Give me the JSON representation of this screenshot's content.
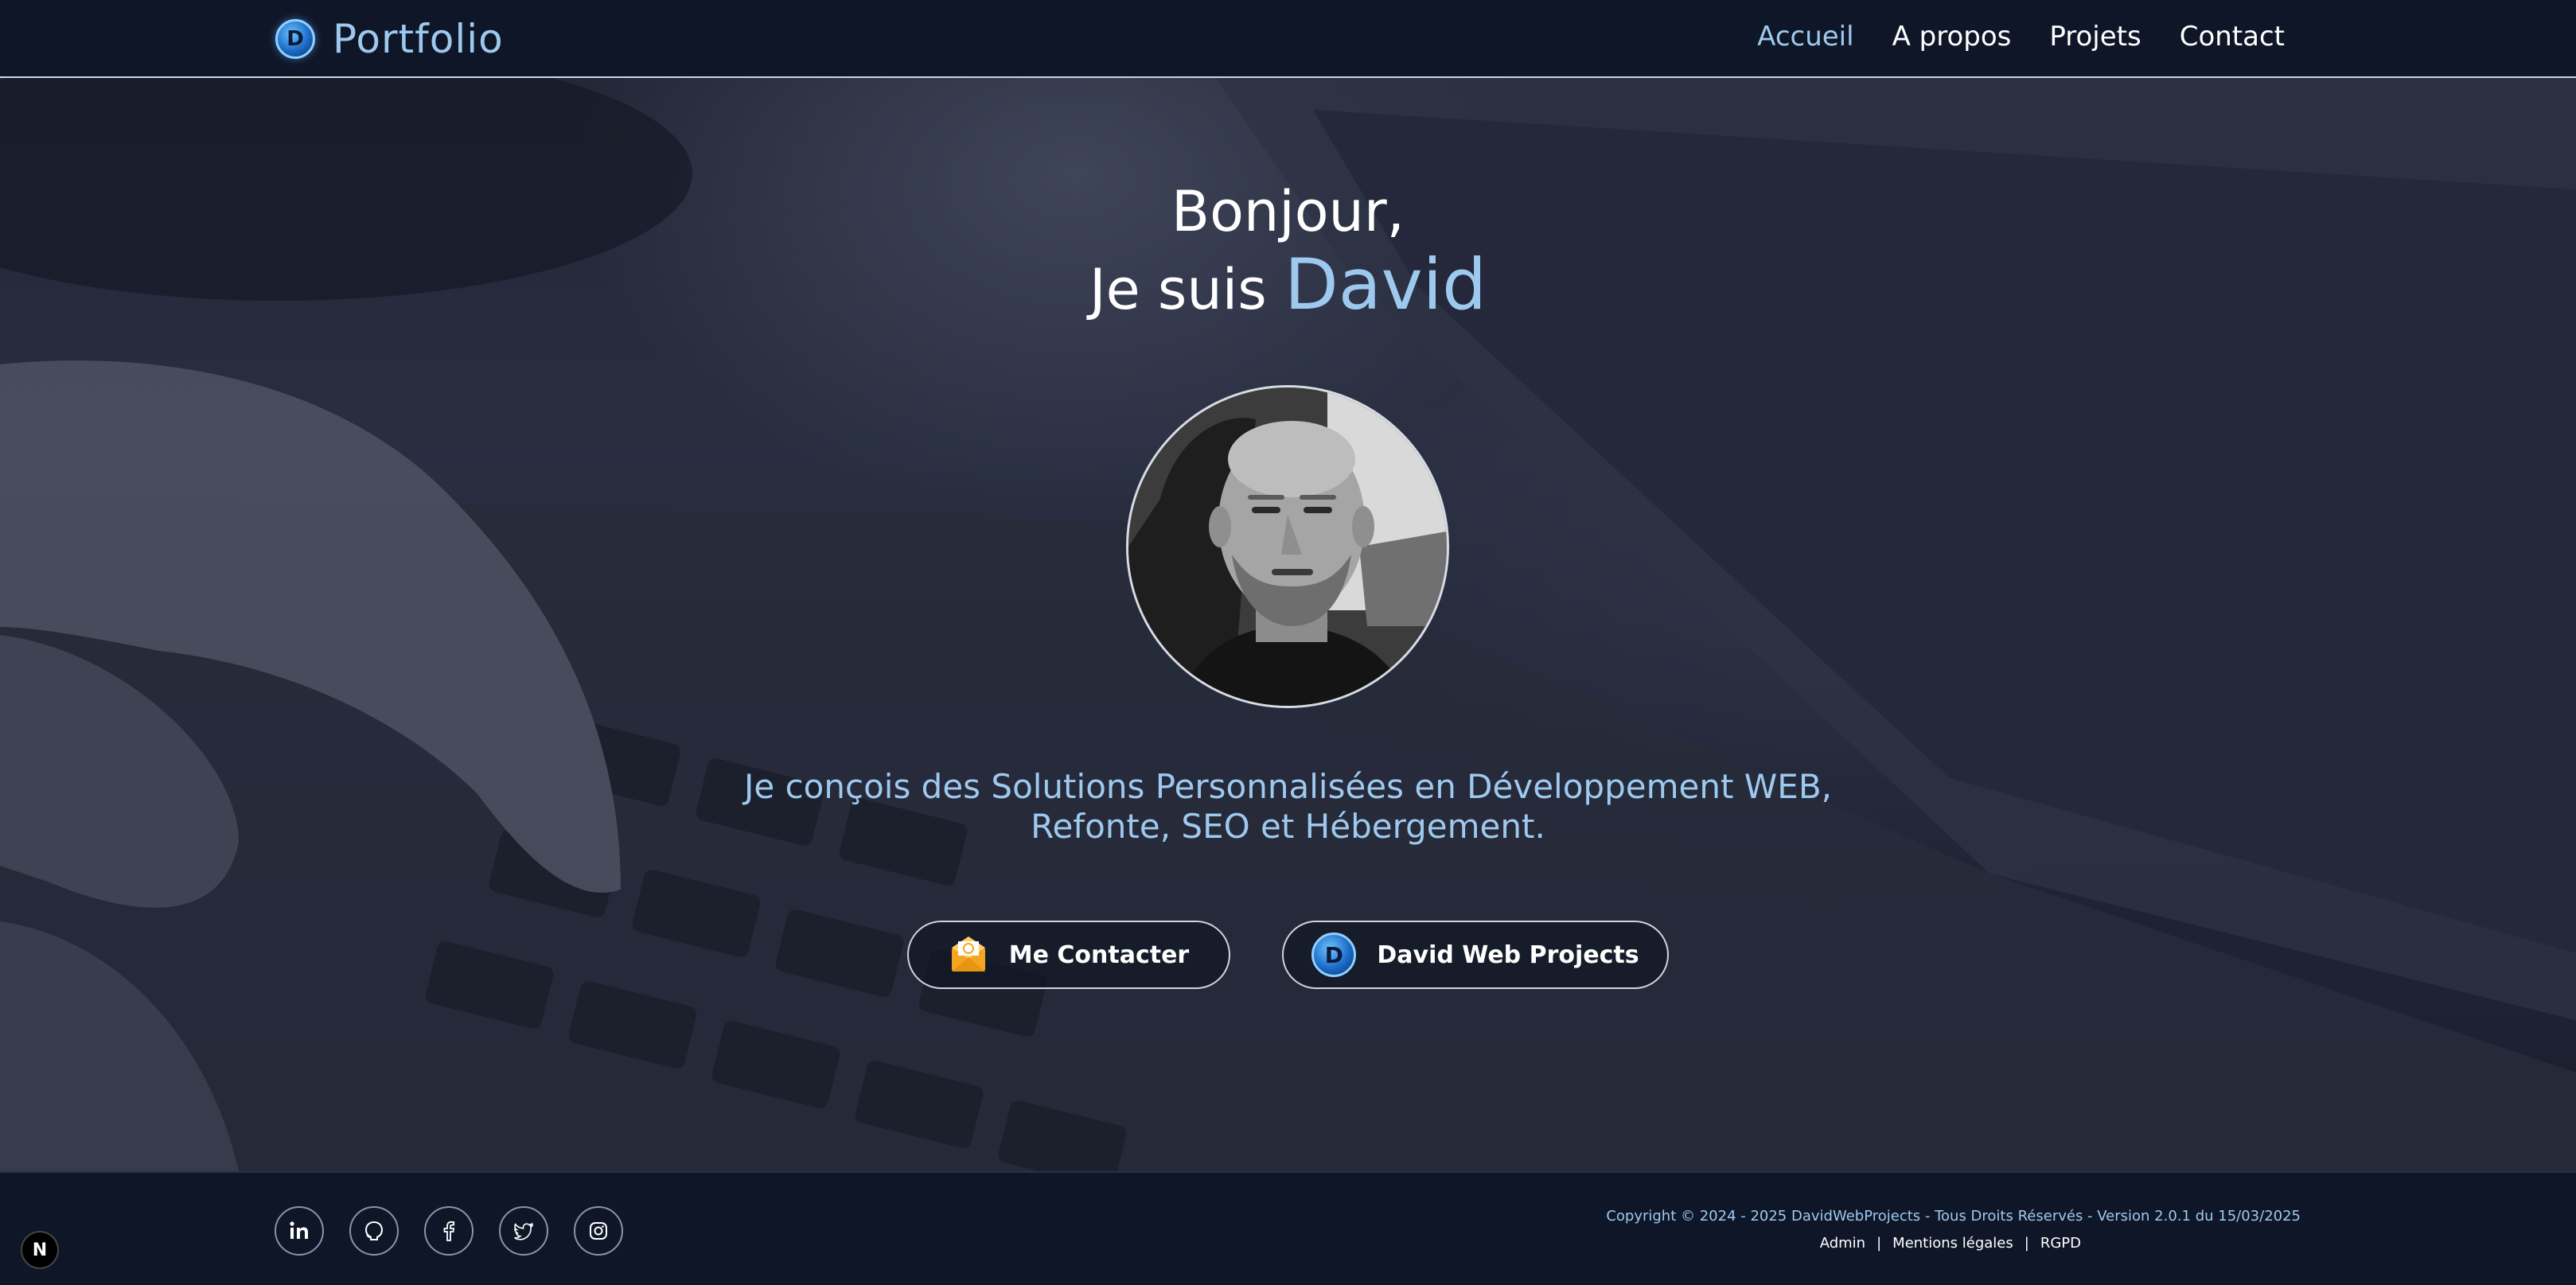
{
  "header": {
    "brand_title": "Portfolio",
    "logo_letter": "D",
    "nav": [
      {
        "label": "Accueil",
        "active": true
      },
      {
        "label": "A propos",
        "active": false
      },
      {
        "label": "Projets",
        "active": false
      },
      {
        "label": "Contact",
        "active": false
      }
    ]
  },
  "hero": {
    "greeting": "Bonjour,",
    "intro": "Je suis",
    "name": "David",
    "tagline_line1": "Je conçois des Solutions Personnalisées en Développement WEB,",
    "tagline_line2": "Refonte, SEO et Hébergement.",
    "buttons": {
      "contact": "Me Contacter",
      "dwp": "David Web Projects"
    }
  },
  "footer": {
    "social": [
      "linkedin-icon",
      "github-icon",
      "facebook-icon",
      "twitter-icon",
      "instagram-icon"
    ],
    "copyright": "Copyright © 2024 - 2025 DavidWebProjects - Tous Droits Réservés - Version 2.0.1 du 15/03/2025",
    "links": {
      "admin": "Admin",
      "sep": "|",
      "mentions": "Mentions légales",
      "rgpd": "RGPD"
    }
  },
  "dev_badge": "N",
  "colors": {
    "accent": "#9ec9ee",
    "background": "#0f1628",
    "text": "#ffffff"
  }
}
